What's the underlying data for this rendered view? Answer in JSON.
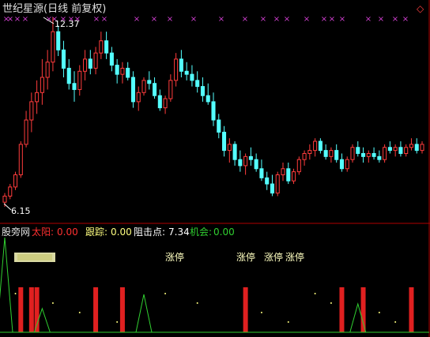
{
  "header": {
    "title": "世纪星源(日线 前复权)",
    "window_glyph": "◇"
  },
  "price_panel": {
    "high_label": "12.37",
    "low_label": "6.15",
    "x_marker": "×",
    "x_marker_color": "#d040d0"
  },
  "indicator_bar": {
    "name": "股旁网",
    "taiyang_label": "太阳:",
    "taiyang_value": "0.00",
    "genzong_label": "跟踪:",
    "genzong_value": "0.00",
    "zujidian_label": "阻击点:",
    "zujidian_value": "7.34",
    "jihui_label": "机会:",
    "jihui_value": "0.00"
  },
  "limit_up_labels": [
    "涨停",
    "涨停",
    "涨停",
    "涨停"
  ],
  "colors": {
    "up": "#ff3c3c",
    "down": "#54ffff",
    "taiyang": "#ff3030",
    "genzong": "#ffff80",
    "zujidian": "#ffffff",
    "jihui": "#30d030",
    "limit_text": "#ffffc0",
    "bar_red": "#e02020",
    "line_green": "#30d030"
  },
  "chart_data": {
    "type": "candlestick",
    "price_high": 12.37,
    "price_low": 6.15,
    "candles": [
      [
        6.3,
        6.6,
        6.15,
        6.5
      ],
      [
        6.5,
        6.9,
        6.4,
        6.8
      ],
      [
        6.8,
        7.3,
        6.7,
        7.2
      ],
      [
        7.2,
        8.3,
        7.1,
        8.2
      ],
      [
        8.2,
        9.3,
        8.1,
        9.0
      ],
      [
        9.0,
        9.9,
        8.6,
        9.6
      ],
      [
        9.6,
        10.3,
        9.2,
        9.9
      ],
      [
        9.9,
        11.0,
        9.5,
        10.4
      ],
      [
        10.4,
        11.3,
        10.0,
        10.9
      ],
      [
        10.9,
        12.37,
        10.6,
        11.9
      ],
      [
        11.9,
        12.1,
        11.1,
        11.3
      ],
      [
        11.3,
        11.6,
        10.4,
        10.7
      ],
      [
        10.7,
        11.0,
        10.0,
        10.2
      ],
      [
        10.2,
        10.6,
        9.6,
        10.0
      ],
      [
        10.0,
        10.8,
        9.8,
        10.6
      ],
      [
        10.6,
        11.3,
        10.3,
        11.0
      ],
      [
        11.0,
        11.3,
        10.5,
        10.7
      ],
      [
        10.7,
        11.4,
        10.5,
        11.2
      ],
      [
        11.2,
        11.9,
        11.0,
        11.6
      ],
      [
        11.6,
        11.9,
        11.0,
        11.2
      ],
      [
        11.2,
        11.4,
        10.6,
        10.8
      ],
      [
        10.8,
        11.0,
        10.2,
        10.5
      ],
      [
        10.5,
        10.9,
        10.2,
        10.7
      ],
      [
        10.7,
        10.9,
        10.3,
        10.4
      ],
      [
        10.4,
        10.6,
        9.4,
        9.6
      ],
      [
        9.6,
        10.1,
        9.3,
        9.9
      ],
      [
        9.9,
        10.4,
        9.8,
        10.3
      ],
      [
        10.3,
        10.6,
        10.0,
        10.2
      ],
      [
        10.2,
        10.4,
        9.7,
        9.8
      ],
      [
        9.8,
        10.0,
        9.3,
        9.4
      ],
      [
        9.4,
        9.8,
        9.2,
        9.7
      ],
      [
        9.7,
        10.5,
        9.6,
        10.3
      ],
      [
        10.3,
        11.2,
        10.1,
        11.0
      ],
      [
        11.0,
        11.3,
        10.4,
        10.6
      ],
      [
        10.6,
        10.9,
        10.3,
        10.5
      ],
      [
        10.5,
        10.8,
        10.1,
        10.3
      ],
      [
        10.3,
        10.6,
        9.9,
        10.1
      ],
      [
        10.1,
        10.4,
        9.6,
        9.8
      ],
      [
        9.8,
        10.2,
        9.5,
        9.6
      ],
      [
        9.6,
        9.9,
        8.8,
        9.0
      ],
      [
        9.0,
        9.2,
        8.4,
        8.6
      ],
      [
        8.6,
        8.8,
        7.8,
        8.0
      ],
      [
        8.0,
        8.4,
        7.6,
        8.2
      ],
      [
        8.2,
        8.3,
        7.5,
        7.7
      ],
      [
        7.7,
        8.0,
        7.3,
        7.5
      ],
      [
        7.5,
        7.9,
        7.2,
        7.8
      ],
      [
        7.8,
        8.1,
        7.5,
        7.7
      ],
      [
        7.7,
        7.9,
        7.3,
        7.4
      ],
      [
        7.4,
        7.7,
        7.0,
        7.1
      ],
      [
        7.1,
        7.3,
        6.7,
        6.9
      ],
      [
        6.9,
        7.2,
        6.5,
        6.6
      ],
      [
        6.6,
        7.3,
        6.5,
        7.2
      ],
      [
        7.2,
        7.6,
        7.0,
        7.4
      ],
      [
        7.4,
        7.6,
        6.9,
        7.0
      ],
      [
        7.0,
        7.4,
        6.9,
        7.3
      ],
      [
        7.3,
        7.8,
        7.2,
        7.7
      ],
      [
        7.7,
        8.0,
        7.5,
        7.9
      ],
      [
        7.9,
        8.2,
        7.7,
        8.0
      ],
      [
        8.0,
        8.4,
        7.8,
        8.3
      ],
      [
        8.3,
        8.4,
        7.9,
        8.0
      ],
      [
        8.0,
        8.2,
        7.7,
        7.8
      ],
      [
        7.8,
        8.1,
        7.6,
        8.0
      ],
      [
        8.0,
        8.2,
        7.6,
        7.7
      ],
      [
        7.7,
        7.9,
        7.3,
        7.4
      ],
      [
        7.4,
        7.8,
        7.3,
        7.7
      ],
      [
        7.7,
        8.2,
        7.6,
        8.1
      ],
      [
        8.1,
        8.3,
        7.8,
        7.9
      ],
      [
        7.9,
        8.1,
        7.6,
        7.8
      ],
      [
        7.8,
        8.0,
        7.6,
        7.9
      ],
      [
        7.9,
        8.1,
        7.7,
        7.8
      ],
      [
        7.8,
        8.0,
        7.6,
        7.7
      ],
      [
        7.7,
        8.2,
        7.6,
        8.1
      ],
      [
        8.1,
        8.3,
        7.9,
        8.0
      ],
      [
        8.0,
        8.2,
        7.8,
        8.1
      ],
      [
        8.1,
        8.3,
        7.8,
        7.9
      ],
      [
        7.9,
        8.2,
        7.8,
        8.1
      ],
      [
        8.1,
        8.4,
        8.0,
        8.2
      ],
      [
        8.2,
        8.4,
        7.9,
        8.0
      ],
      [
        8.0,
        8.3,
        7.9,
        8.2
      ]
    ],
    "taiyang_bars": [
      3,
      5,
      6,
      17,
      22,
      45,
      63,
      67,
      76
    ],
    "jihui_spikes": [
      [
        0,
        1.0
      ],
      [
        7,
        0.25
      ],
      [
        26,
        0.4
      ],
      [
        66,
        0.3
      ]
    ],
    "genzong_dots": [
      2,
      9,
      14,
      21,
      30,
      36,
      48,
      53,
      58,
      61,
      70,
      73
    ],
    "limit_up_days": [
      45,
      63,
      67,
      72
    ]
  }
}
